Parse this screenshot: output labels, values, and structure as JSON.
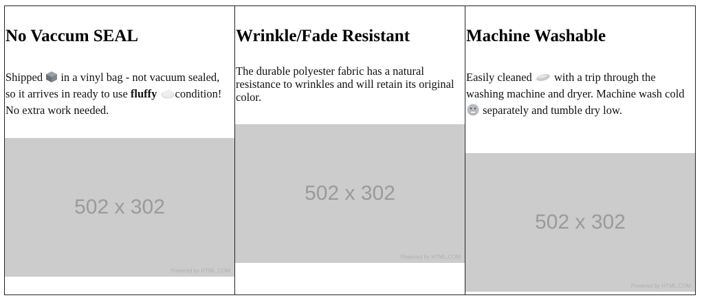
{
  "cards": [
    {
      "title": "No Vaccum SEAL",
      "text_1": "Shipped",
      "icon_1": "package-icon",
      "text_2": " in a vinyl bag - not vacuum sealed, so it arrives in ready to use ",
      "bold": "fluffy",
      "icon_2": "cloud-icon",
      "text_3": "condition! No extra work needed.",
      "placeholder": "502 x 302",
      "powered": "Powered by HTML.COM"
    },
    {
      "title": "Wrinkle/Fade Resistant",
      "text_1": "The durable polyester fabric has a natural resistance to wrinkles and will retain its original color.",
      "placeholder": "502 x 302",
      "powered": "Powered by HTML.COM"
    },
    {
      "title": "Machine Washable",
      "text_1": "Easily cleaned ",
      "icon_1": "soap-icon",
      "text_2": " with a trip through the washing machine and dryer. Machine wash cold ",
      "icon_2": "cold-face-icon",
      "text_3": " separately and tumble dry low.",
      "placeholder": "502 x 302",
      "powered": "Powered by HTML.COM"
    }
  ]
}
